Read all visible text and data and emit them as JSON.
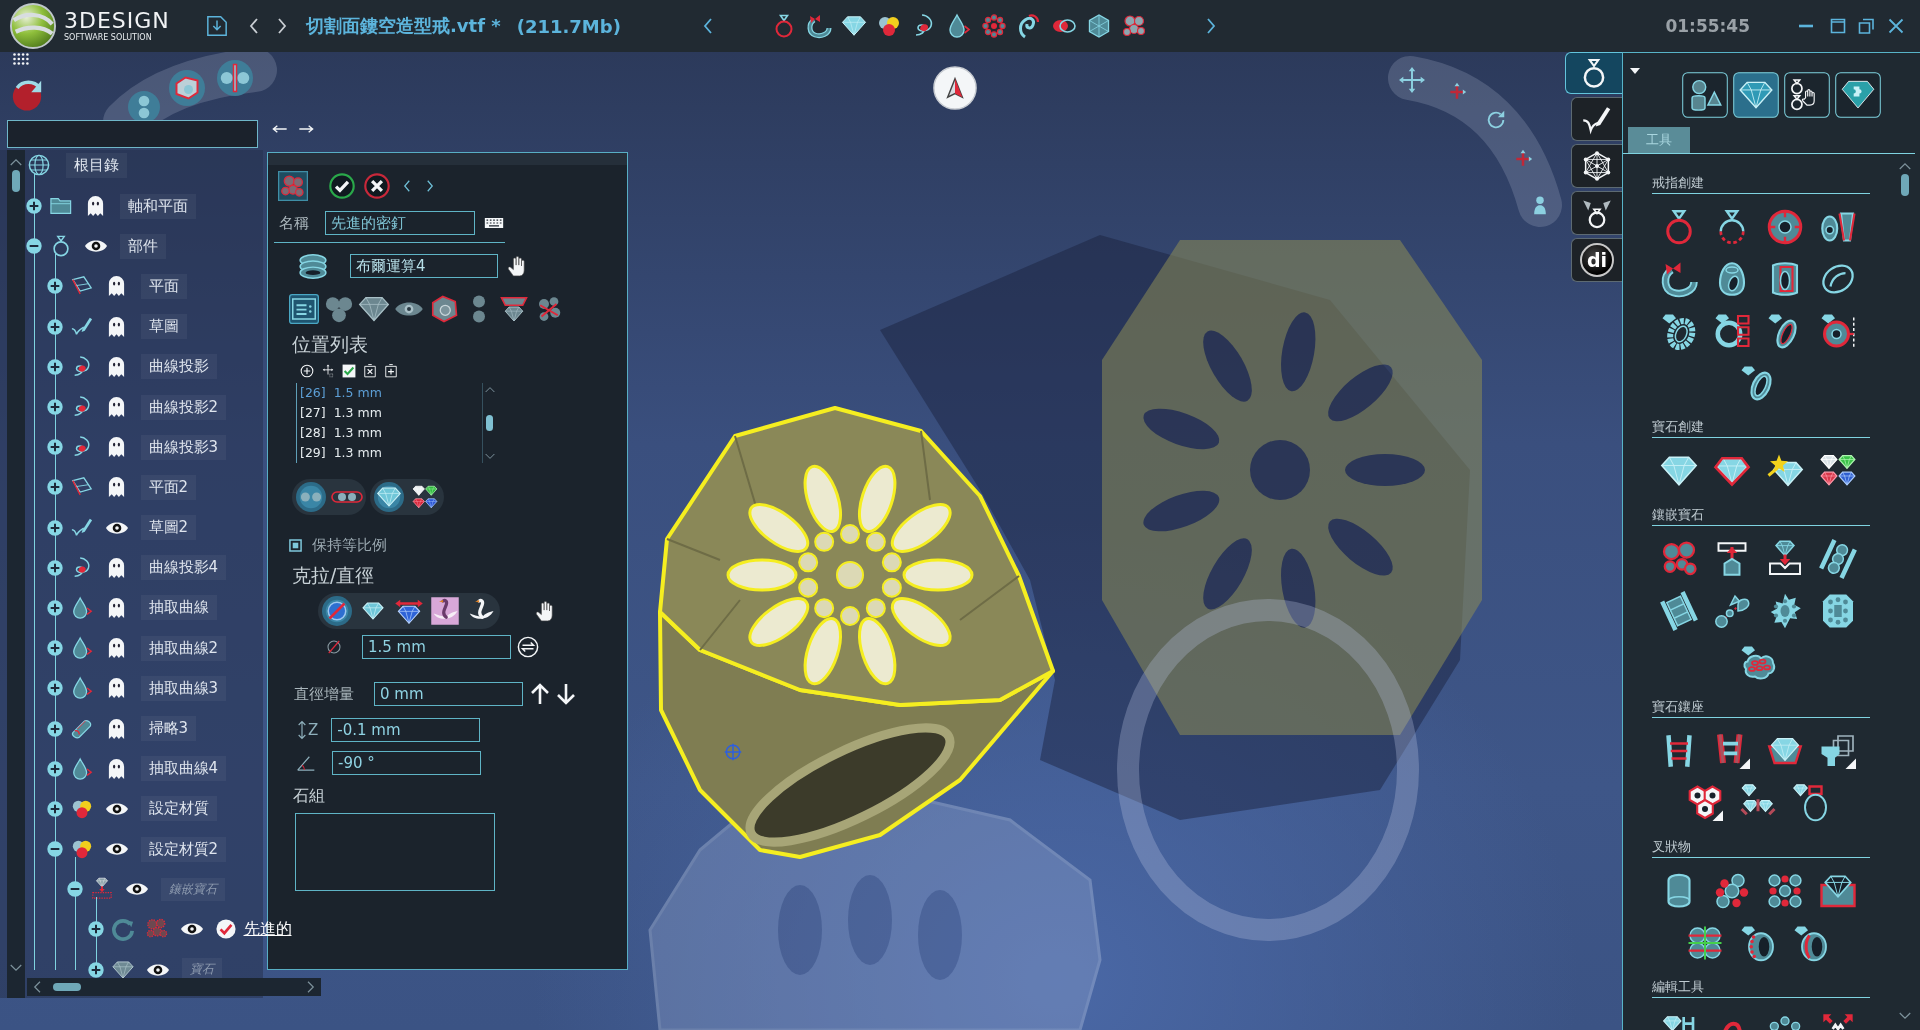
{
  "title_bar": {
    "logo_text": "3DESIGN",
    "logo_tagline": "SOFTWARE SOLUTION",
    "document": "切割面鏤空造型戒.vtf *",
    "file_size": "(211.7Mb)",
    "clock": "01:55:45"
  },
  "tree": [
    {
      "label": "根目錄",
      "kind": "globe",
      "children": [
        {
          "label": "軸和平面",
          "kind": "folder",
          "expanded": false,
          "visible": false
        },
        {
          "label": "部件",
          "kind": "ring",
          "expanded": true,
          "visible": true,
          "children": [
            {
              "label": "平面",
              "kind": "plane",
              "expanded": false,
              "visible": false
            },
            {
              "label": "草圖",
              "kind": "sketch",
              "expanded": false,
              "visible": false
            },
            {
              "label": "曲線投影",
              "kind": "projection",
              "expanded": false,
              "visible": false
            },
            {
              "label": "曲線投影2",
              "kind": "projection",
              "expanded": false,
              "visible": false
            },
            {
              "label": "曲線投影3",
              "kind": "projection",
              "expanded": false,
              "visible": false
            },
            {
              "label": "平面2",
              "kind": "plane",
              "expanded": false,
              "visible": false
            },
            {
              "label": "草圖2",
              "kind": "sketch",
              "expanded": false,
              "visible": true
            },
            {
              "label": "曲線投影4",
              "kind": "projection",
              "expanded": false,
              "visible": false
            },
            {
              "label": "抽取曲線",
              "kind": "extract",
              "expanded": false,
              "visible": false
            },
            {
              "label": "抽取曲線2",
              "kind": "extract",
              "expanded": false,
              "visible": false
            },
            {
              "label": "抽取曲線3",
              "kind": "extract",
              "expanded": false,
              "visible": false
            },
            {
              "label": "掃略3",
              "kind": "sweep",
              "expanded": false,
              "visible": false
            },
            {
              "label": "抽取曲線4",
              "kind": "extract",
              "expanded": false,
              "visible": false
            },
            {
              "label": "設定材質",
              "kind": "material",
              "expanded": false,
              "visible": true
            },
            {
              "label": "設定材質2",
              "kind": "material",
              "expanded": true,
              "visible": true,
              "children": [
                {
                  "label": "鑲嵌寶石",
                  "kind": "gem-setting",
                  "expanded": true,
                  "visible": true,
                  "dimmed": true,
                  "children": [
                    {
                      "label": "先進的",
                      "kind": "pave",
                      "expanded": false,
                      "visible": true,
                      "checked": true,
                      "selected": true,
                      "dimmed": false
                    },
                    {
                      "label": "寶石",
                      "kind": "gem",
                      "expanded": false,
                      "visible": true,
                      "checked": false,
                      "selected": false,
                      "dimmed": true
                    }
                  ]
                }
              ]
            }
          ]
        }
      ]
    }
  ],
  "feature_panel": {
    "name": {
      "label": "名稱",
      "value": "先進的密釘"
    },
    "boolean": {
      "value": "布爾運算4"
    },
    "option_tabs": [
      {
        "kind": "list",
        "selected": true
      },
      {
        "kind": "circles",
        "selected": false
      },
      {
        "kind": "diamond",
        "selected": false
      },
      {
        "kind": "eye",
        "selected": false
      },
      {
        "kind": "seat",
        "selected": false
      },
      {
        "kind": "dots",
        "selected": false
      },
      {
        "kind": "mirror",
        "selected": false
      },
      {
        "kind": "cluster",
        "selected": false
      }
    ],
    "position_list": {
      "title": "位置列表",
      "rows": [
        {
          "index": "[26]",
          "value": "1.5 mm",
          "selected": true
        },
        {
          "index": "[27]",
          "value": "1.3 mm",
          "selected": false
        },
        {
          "index": "[28]",
          "value": "1.3 mm",
          "selected": false
        },
        {
          "index": "[29]",
          "value": "1.3 mm",
          "selected": false
        }
      ]
    },
    "layout_toggles": [
      {
        "kind": "dots",
        "selected": true
      },
      {
        "kind": "linked-dots",
        "selected": false
      }
    ],
    "gem_toggles": [
      {
        "kind": "diamond",
        "selected": true
      },
      {
        "kind": "colored-gems",
        "selected": false
      }
    ],
    "keep_ratio": {
      "label": "保持等比例",
      "checked": true
    },
    "size": {
      "title": "克拉/直徑",
      "modes": [
        {
          "kind": "diameter",
          "selected": true
        },
        {
          "kind": "diamond",
          "selected": false
        },
        {
          "kind": "width",
          "selected": false
        },
        {
          "kind": "swan-tile",
          "selected": false
        },
        {
          "kind": "swan",
          "selected": false
        }
      ],
      "diameter": "1.5 mm"
    },
    "increment": {
      "label": "直徑增量",
      "value": "0 mm"
    },
    "z_offset": {
      "label": "Z",
      "value": "-0.1 mm"
    },
    "angle": {
      "value": "-90 °"
    },
    "stone_group": {
      "label": "石組"
    }
  },
  "side_tabs": [
    {
      "kind": "ring",
      "selected": true
    },
    {
      "kind": "sketch",
      "selected": false
    },
    {
      "kind": "mesh",
      "selected": false
    },
    {
      "kind": "ring-gems",
      "selected": false
    },
    {
      "kind": "badge",
      "label": "di",
      "selected": false
    }
  ],
  "tool_panel": {
    "categories": [
      {
        "kind": "shapes",
        "selected": false
      },
      {
        "kind": "diamond",
        "selected": true
      },
      {
        "kind": "rings-hand",
        "selected": false
      },
      {
        "kind": "puzzle",
        "selected": false
      }
    ],
    "tabs": [
      {
        "label": "工具",
        "selected": true
      }
    ],
    "sections": [
      {
        "title": "戒指創建"
      },
      {
        "title": "寶石創建"
      },
      {
        "title": "鑲嵌寶石"
      },
      {
        "title": "寶石鑲座"
      },
      {
        "title": "叉狀物"
      },
      {
        "title": "編輯工具"
      }
    ]
  }
}
